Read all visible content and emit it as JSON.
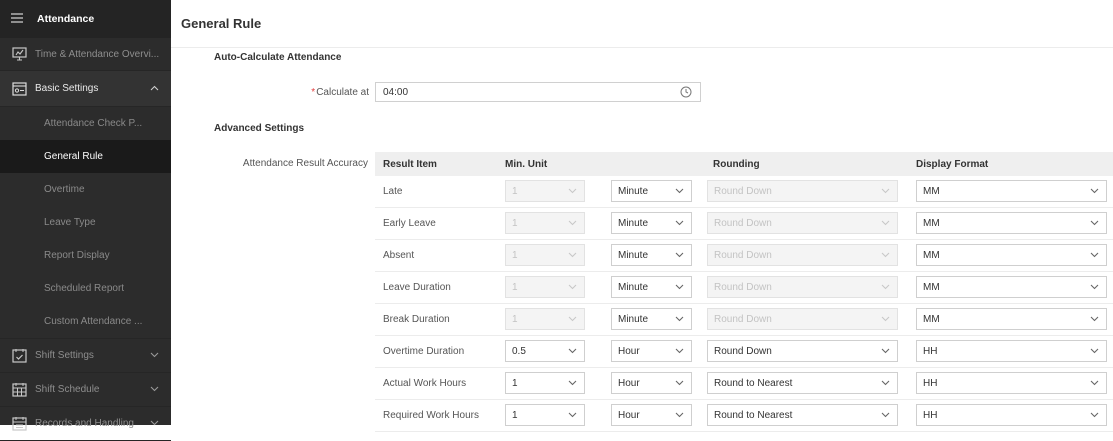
{
  "sidebar": {
    "header": "Attendance",
    "items": [
      {
        "label": "Time & Attendance Overvi..."
      },
      {
        "label": "Basic Settings"
      },
      {
        "label": "Shift Settings"
      },
      {
        "label": "Shift Schedule"
      },
      {
        "label": "Records and Handling"
      }
    ],
    "subitems": [
      "Attendance Check P...",
      "General Rule",
      "Overtime",
      "Leave Type",
      "Report Display",
      "Scheduled Report",
      "Custom Attendance ..."
    ]
  },
  "page": {
    "title": "General Rule",
    "auto_calc_title": "Auto-Calculate Attendance",
    "calc_label": "Calculate at",
    "calc_required": "*",
    "calc_value": "04:00",
    "advanced_title": "Advanced Settings",
    "accuracy_label": "Attendance Result Accuracy"
  },
  "table": {
    "headers": [
      "Result Item",
      "Min. Unit",
      "Rounding",
      "Display Format"
    ],
    "rows": [
      {
        "item": "Late",
        "min": "1",
        "unit": "Minute",
        "rounding": "Round Down",
        "format": "MM",
        "disabled": true
      },
      {
        "item": "Early Leave",
        "min": "1",
        "unit": "Minute",
        "rounding": "Round Down",
        "format": "MM",
        "disabled": true
      },
      {
        "item": "Absent",
        "min": "1",
        "unit": "Minute",
        "rounding": "Round Down",
        "format": "MM",
        "disabled": true
      },
      {
        "item": "Leave Duration",
        "min": "1",
        "unit": "Minute",
        "rounding": "Round Down",
        "format": "MM",
        "disabled": true
      },
      {
        "item": "Break Duration",
        "min": "1",
        "unit": "Minute",
        "rounding": "Round Down",
        "format": "MM",
        "disabled": true
      },
      {
        "item": "Overtime Duration",
        "min": "0.5",
        "unit": "Hour",
        "rounding": "Round Down",
        "format": "HH",
        "disabled": false
      },
      {
        "item": "Actual Work Hours",
        "min": "1",
        "unit": "Hour",
        "rounding": "Round to Nearest",
        "format": "HH",
        "disabled": false
      },
      {
        "item": "Required Work Hours",
        "min": "1",
        "unit": "Hour",
        "rounding": "Round to Nearest",
        "format": "HH",
        "disabled": false
      }
    ]
  }
}
